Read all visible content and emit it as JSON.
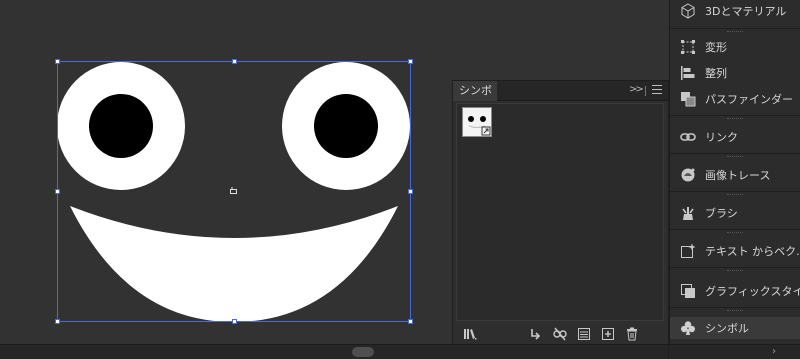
{
  "symbols_panel": {
    "tab_label": "シンボル",
    "expand_glyph": ">>",
    "menu_icon": "hamburger-menu-icon",
    "symbols": [
      {
        "name": "smiley-face-symbol"
      }
    ],
    "bottom_icons": [
      "symbol-libraries-icon",
      "place-symbol-icon",
      "break-link-icon",
      "symbol-options-icon",
      "new-symbol-icon",
      "delete-icon"
    ]
  },
  "dock": {
    "items": [
      {
        "label": "3Dとマテリアル",
        "icon": "cube-icon"
      },
      {
        "label": "変形",
        "icon": "transform-icon"
      },
      {
        "label": "整列",
        "icon": "align-icon"
      },
      {
        "label": "パスファインダー",
        "icon": "pathfinder-icon"
      },
      {
        "label": "リンク",
        "icon": "link-icon"
      },
      {
        "label": "画像トレース",
        "icon": "image-trace-icon"
      },
      {
        "label": "ブラシ",
        "icon": "brush-icon"
      },
      {
        "label": "テキスト からベク...",
        "icon": "text-to-vector-icon"
      },
      {
        "label": "グラフィックスタイル",
        "icon": "graphic-style-icon"
      },
      {
        "label": "シンボル",
        "icon": "club-icon",
        "active": true
      }
    ]
  },
  "bottom_bar": {
    "collapse_glyph": "›"
  },
  "colors": {
    "selection": "#4a6ad6",
    "canvas": "#323232",
    "panel": "#2e2e2e",
    "dock": "#2c2c2c"
  }
}
